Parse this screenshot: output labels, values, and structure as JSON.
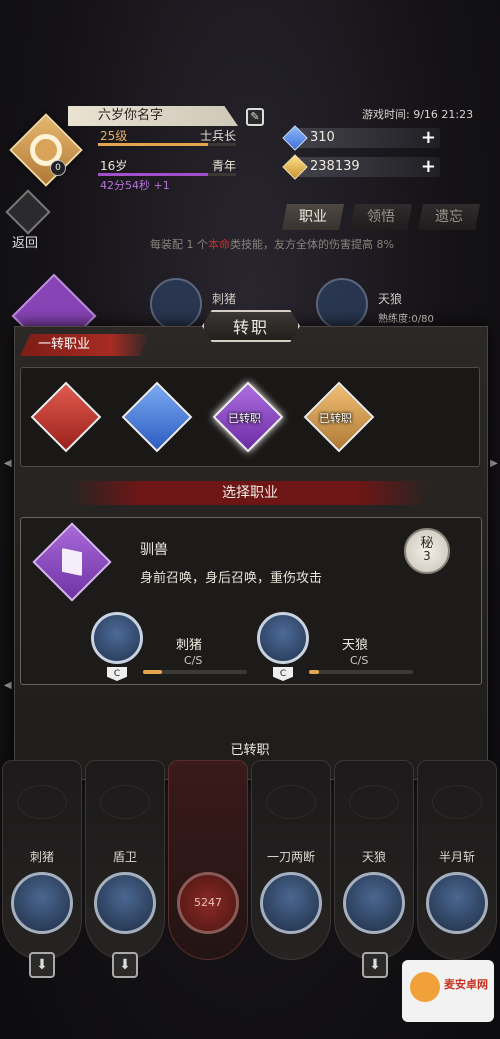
{
  "player": {
    "name": "六岁你名字",
    "avatar_badge": "0",
    "level": "25级",
    "rank": "士兵长",
    "age": "16岁",
    "stage": "青年",
    "timer": "42分54秒 +1",
    "level_progress": 0.8,
    "age_progress": 0.8
  },
  "game_time": "游戏时间: 9/16 21:23",
  "resources": {
    "gems": "310",
    "gold": "238139"
  },
  "back_label": "返回",
  "tabs": [
    "职业",
    "领悟",
    "遗忘"
  ],
  "hint": {
    "prefix": "每装配 1 个",
    "red": "本命",
    "suffix": "类技能，友方全体的伤害提高 8%"
  },
  "background_skills": [
    {
      "name": "刺猪",
      "sub": ""
    },
    {
      "name": "天狼",
      "sub": "熟练度:0/80"
    }
  ],
  "modal": {
    "title": "转职",
    "section": "一转职业",
    "jobs": [
      {
        "color": "#c0352c",
        "label": ""
      },
      {
        "color": "#3d73d4",
        "label": ""
      },
      {
        "color": "#8c45bf",
        "label": "已转职"
      },
      {
        "color": "#d49a4a",
        "label": "已转职"
      }
    ],
    "select_label": "选择职业",
    "detail": {
      "name": "驯兽",
      "desc": "身前召唤，身后召唤，重伤攻击",
      "badge_top": "秘",
      "badge_num": "3",
      "skills": [
        {
          "name": "刺猪",
          "grade": "C",
          "cs": "C/S",
          "progress": 0.18,
          "icon": "claw-icon"
        },
        {
          "name": "天狼",
          "grade": "C",
          "cs": "C/S",
          "progress": 0.1,
          "icon": "wolf-fang-icon"
        }
      ]
    },
    "confirm": "已转职"
  },
  "skill_bar": [
    {
      "label": "刺猪",
      "icon": "claw-icon"
    },
    {
      "label": "盾卫",
      "icon": "shield-icon"
    },
    {
      "label": "",
      "icon": "power-orb",
      "value": "5247"
    },
    {
      "label": "一刀两断",
      "icon": "slash-icon"
    },
    {
      "label": "天狼",
      "icon": "wolf-fang-icon"
    },
    {
      "label": "半月斩",
      "icon": "crescent-icon"
    }
  ],
  "watermark": "麦安卓网",
  "colors": {
    "gold": "#e3b067",
    "purple": "#b873d8",
    "red": "#c1352e"
  }
}
